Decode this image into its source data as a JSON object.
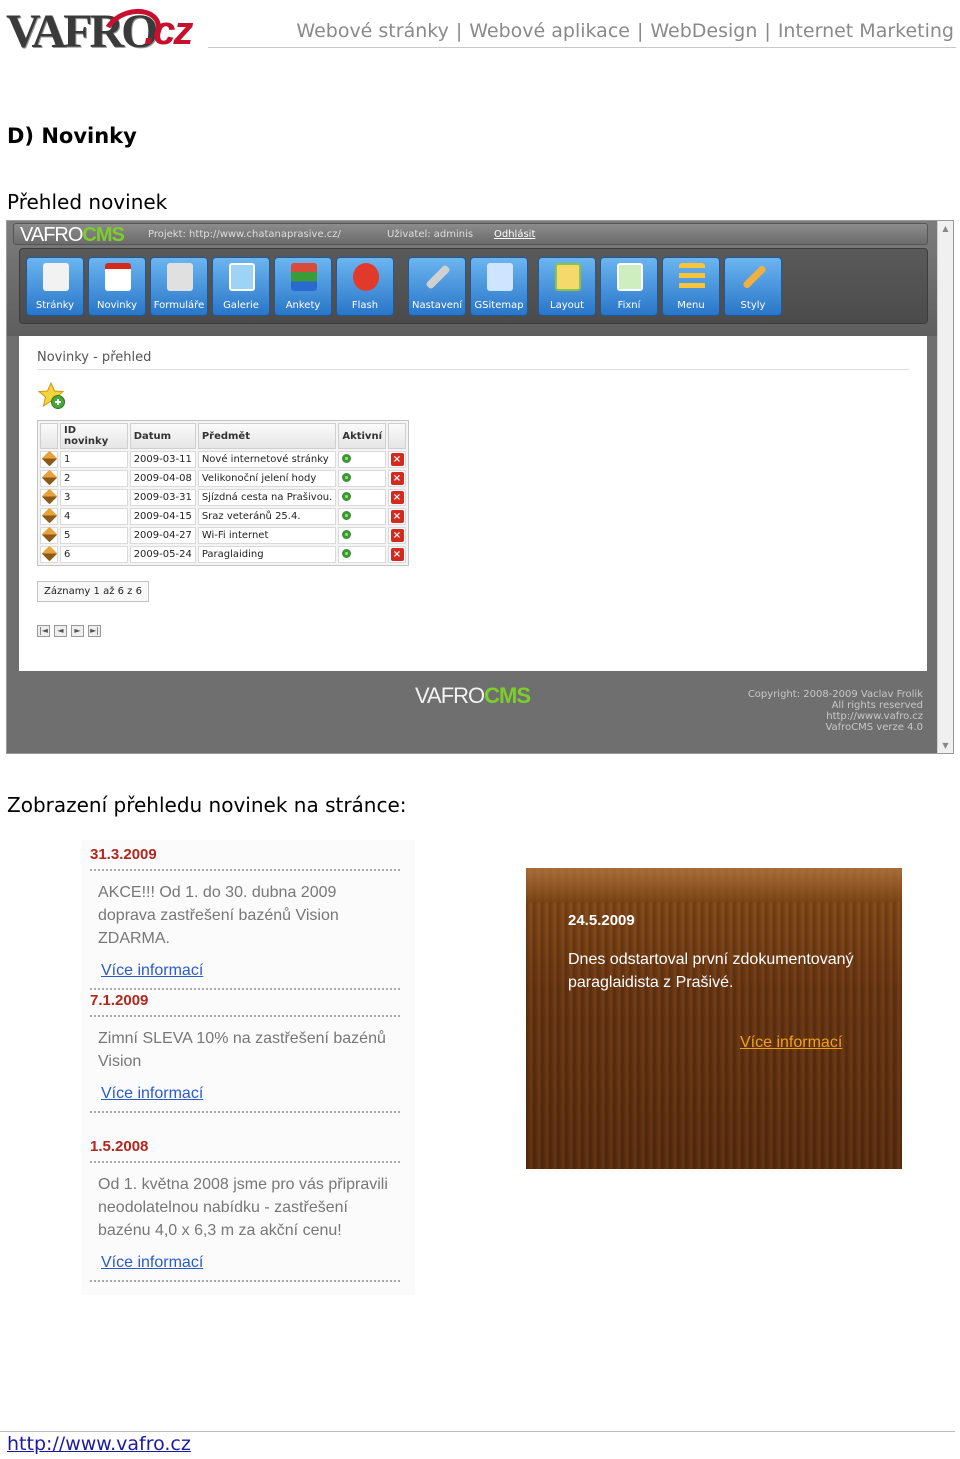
{
  "header": {
    "logo_text": "VAFRO",
    "logo_domain": ".cz",
    "nav": [
      "Webové stránky",
      "Webové aplikace",
      "WebDesign",
      "Internet Marketing"
    ],
    "separator": "|"
  },
  "section_title": "D) Novinky",
  "subtitle_overview": "Přehled novinek",
  "subtitle_display": "Zobrazení přehledu novinek na stránce:",
  "cms": {
    "logo_a": "VAFRO",
    "logo_b": "CMS",
    "project": "Projekt: http://www.chatanaprasive.cz/",
    "user": "Uživatel: adminis",
    "logout": "Odhlásit",
    "tools": [
      {
        "label": "Stránky",
        "icon": "page-icon",
        "color": "#f2f2f2"
      },
      {
        "label": "Novinky",
        "icon": "calendar-icon",
        "color": "#ffffff"
      },
      {
        "label": "Formuláře",
        "icon": "form-icon",
        "color": "#e0e0e0"
      },
      {
        "label": "Galerie",
        "icon": "gallery-icon",
        "color": "#9fd3f5"
      },
      {
        "label": "Ankety",
        "icon": "poll-icon",
        "color": "#d84a3a"
      },
      {
        "label": "Flash",
        "icon": "flash-icon",
        "color": "#e23a2a"
      },
      {
        "label": "Nastavení",
        "icon": "wrench-icon",
        "color": "#d0d0d0"
      },
      {
        "label": "GSitemap",
        "icon": "sitemap-icon",
        "color": "#cfe5ff"
      },
      {
        "label": "Layout",
        "icon": "layout-icon",
        "color": "#f5d96a"
      },
      {
        "label": "Fixní",
        "icon": "fixed-icon",
        "color": "#cfeec0"
      },
      {
        "label": "Menu",
        "icon": "menu-icon",
        "color": "#f7c43a"
      },
      {
        "label": "Styly",
        "icon": "brush-icon",
        "color": "#f0b040"
      }
    ],
    "page_title": "Novinky - přehled",
    "table": {
      "headers": [
        "ID novinky",
        "Datum",
        "Předmět",
        "Aktivní"
      ],
      "rows": [
        [
          "1",
          "2009-03-11",
          "Nové internetové stránky"
        ],
        [
          "2",
          "2009-04-08",
          "Velikonoční jelení hody"
        ],
        [
          "3",
          "2009-03-31",
          "Sjízdná cesta na Prašivou."
        ],
        [
          "4",
          "2009-04-15",
          "Sraz veteránů 25.4."
        ],
        [
          "5",
          "2009-04-27",
          "Wi-Fi internet"
        ],
        [
          "6",
          "2009-05-24",
          "Paraglaiding"
        ]
      ]
    },
    "records": "Záznamy 1 až 6 z 6",
    "pager": [
      "|◄",
      "◄",
      "►",
      "►|"
    ],
    "footer_logo_a": "VAFRO",
    "footer_logo_b": "CMS",
    "copyright": [
      "Copyright: 2008-2009 Vaclav Frolik",
      "All rights reserved",
      "http://www.vafro.cz",
      "VafroCMS verze 4.0"
    ]
  },
  "news": [
    {
      "date": "31.3.2009",
      "text": "AKCE!!! Od 1. do 30. dubna 2009 doprava zastřešení bazénů Vision ZDARMA.",
      "more": "Více informací"
    },
    {
      "date": "7.1.2009",
      "text": "Zimní SLEVA 10% na zastřešení bazénů Vision",
      "more": "Více informací"
    },
    {
      "date": "1.5.2008",
      "text": "Od 1. května 2008 jsme pro vás připravili neodolatelnou nabídku - zastřešení bazénu 4,0 x 6,3 m za akční cenu!",
      "more": "Více informací"
    }
  ],
  "banner": {
    "date": "24.5.2009",
    "text": "Dnes odstartoval první zdokumentovaný paraglaidista z Prašivé.",
    "more": "Více informací"
  },
  "footer": {
    "url": "http://www.vafro.cz"
  }
}
